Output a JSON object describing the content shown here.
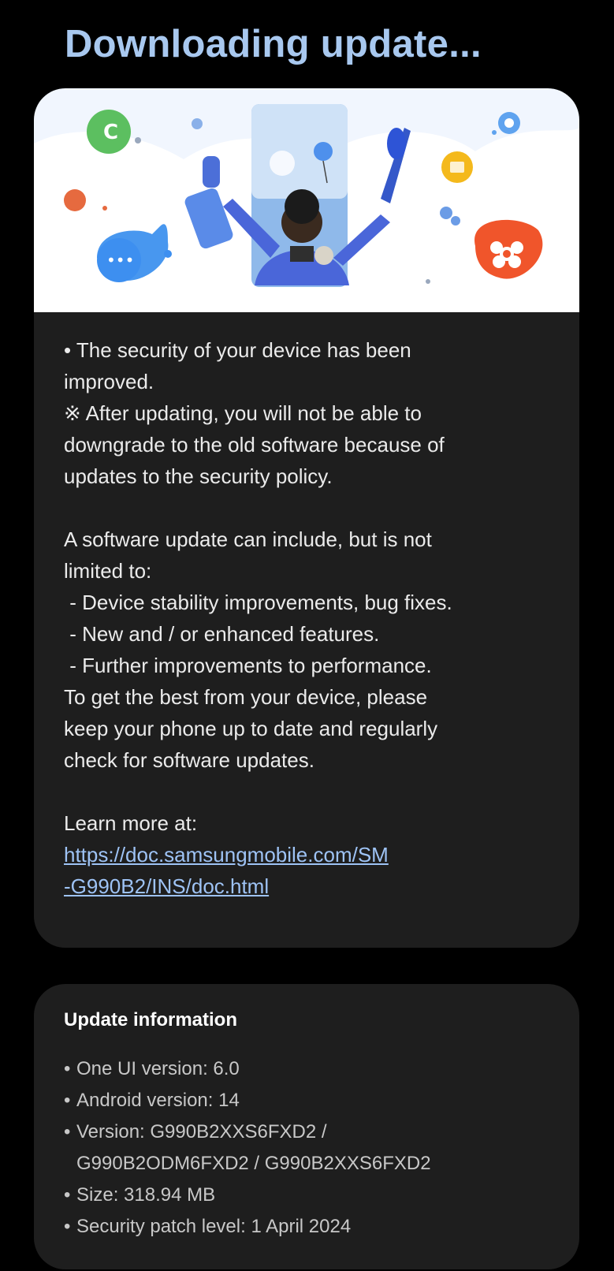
{
  "header": {
    "title": "Downloading update..."
  },
  "release_notes": {
    "lines_1": [
      "• The security of your device has been",
      "improved.",
      "※ After updating, you will not be able to",
      "downgrade to the old software because of",
      "updates to the security policy."
    ],
    "lines_2": [
      "A software update can include, but is not",
      "limited to:",
      " - Device stability improvements, bug fixes.",
      " - New and / or enhanced features.",
      " - Further improvements to performance.",
      "To get the best from your device, please",
      "keep your phone up to date and regularly",
      "check for software updates."
    ],
    "learn_more": "Learn more at:",
    "link_line1": "https://doc.samsungmobile.com/SM",
    "link_line2": "-G990B2/INS/doc.html"
  },
  "update_info": {
    "title": "Update information",
    "items": [
      "One UI version: 6.0",
      "Android version: 14",
      "Version: G990B2XXS6FXD2 /",
      "G990B2ODM6FXD2 / G990B2XXS6FXD2",
      "Size: 318.94 MB",
      "Security patch level: 1 April 2024"
    ]
  },
  "colors": {
    "background": "#000000",
    "card": "#1e1e1e",
    "title": "#a8c8ef",
    "link": "#9ec3f5"
  }
}
